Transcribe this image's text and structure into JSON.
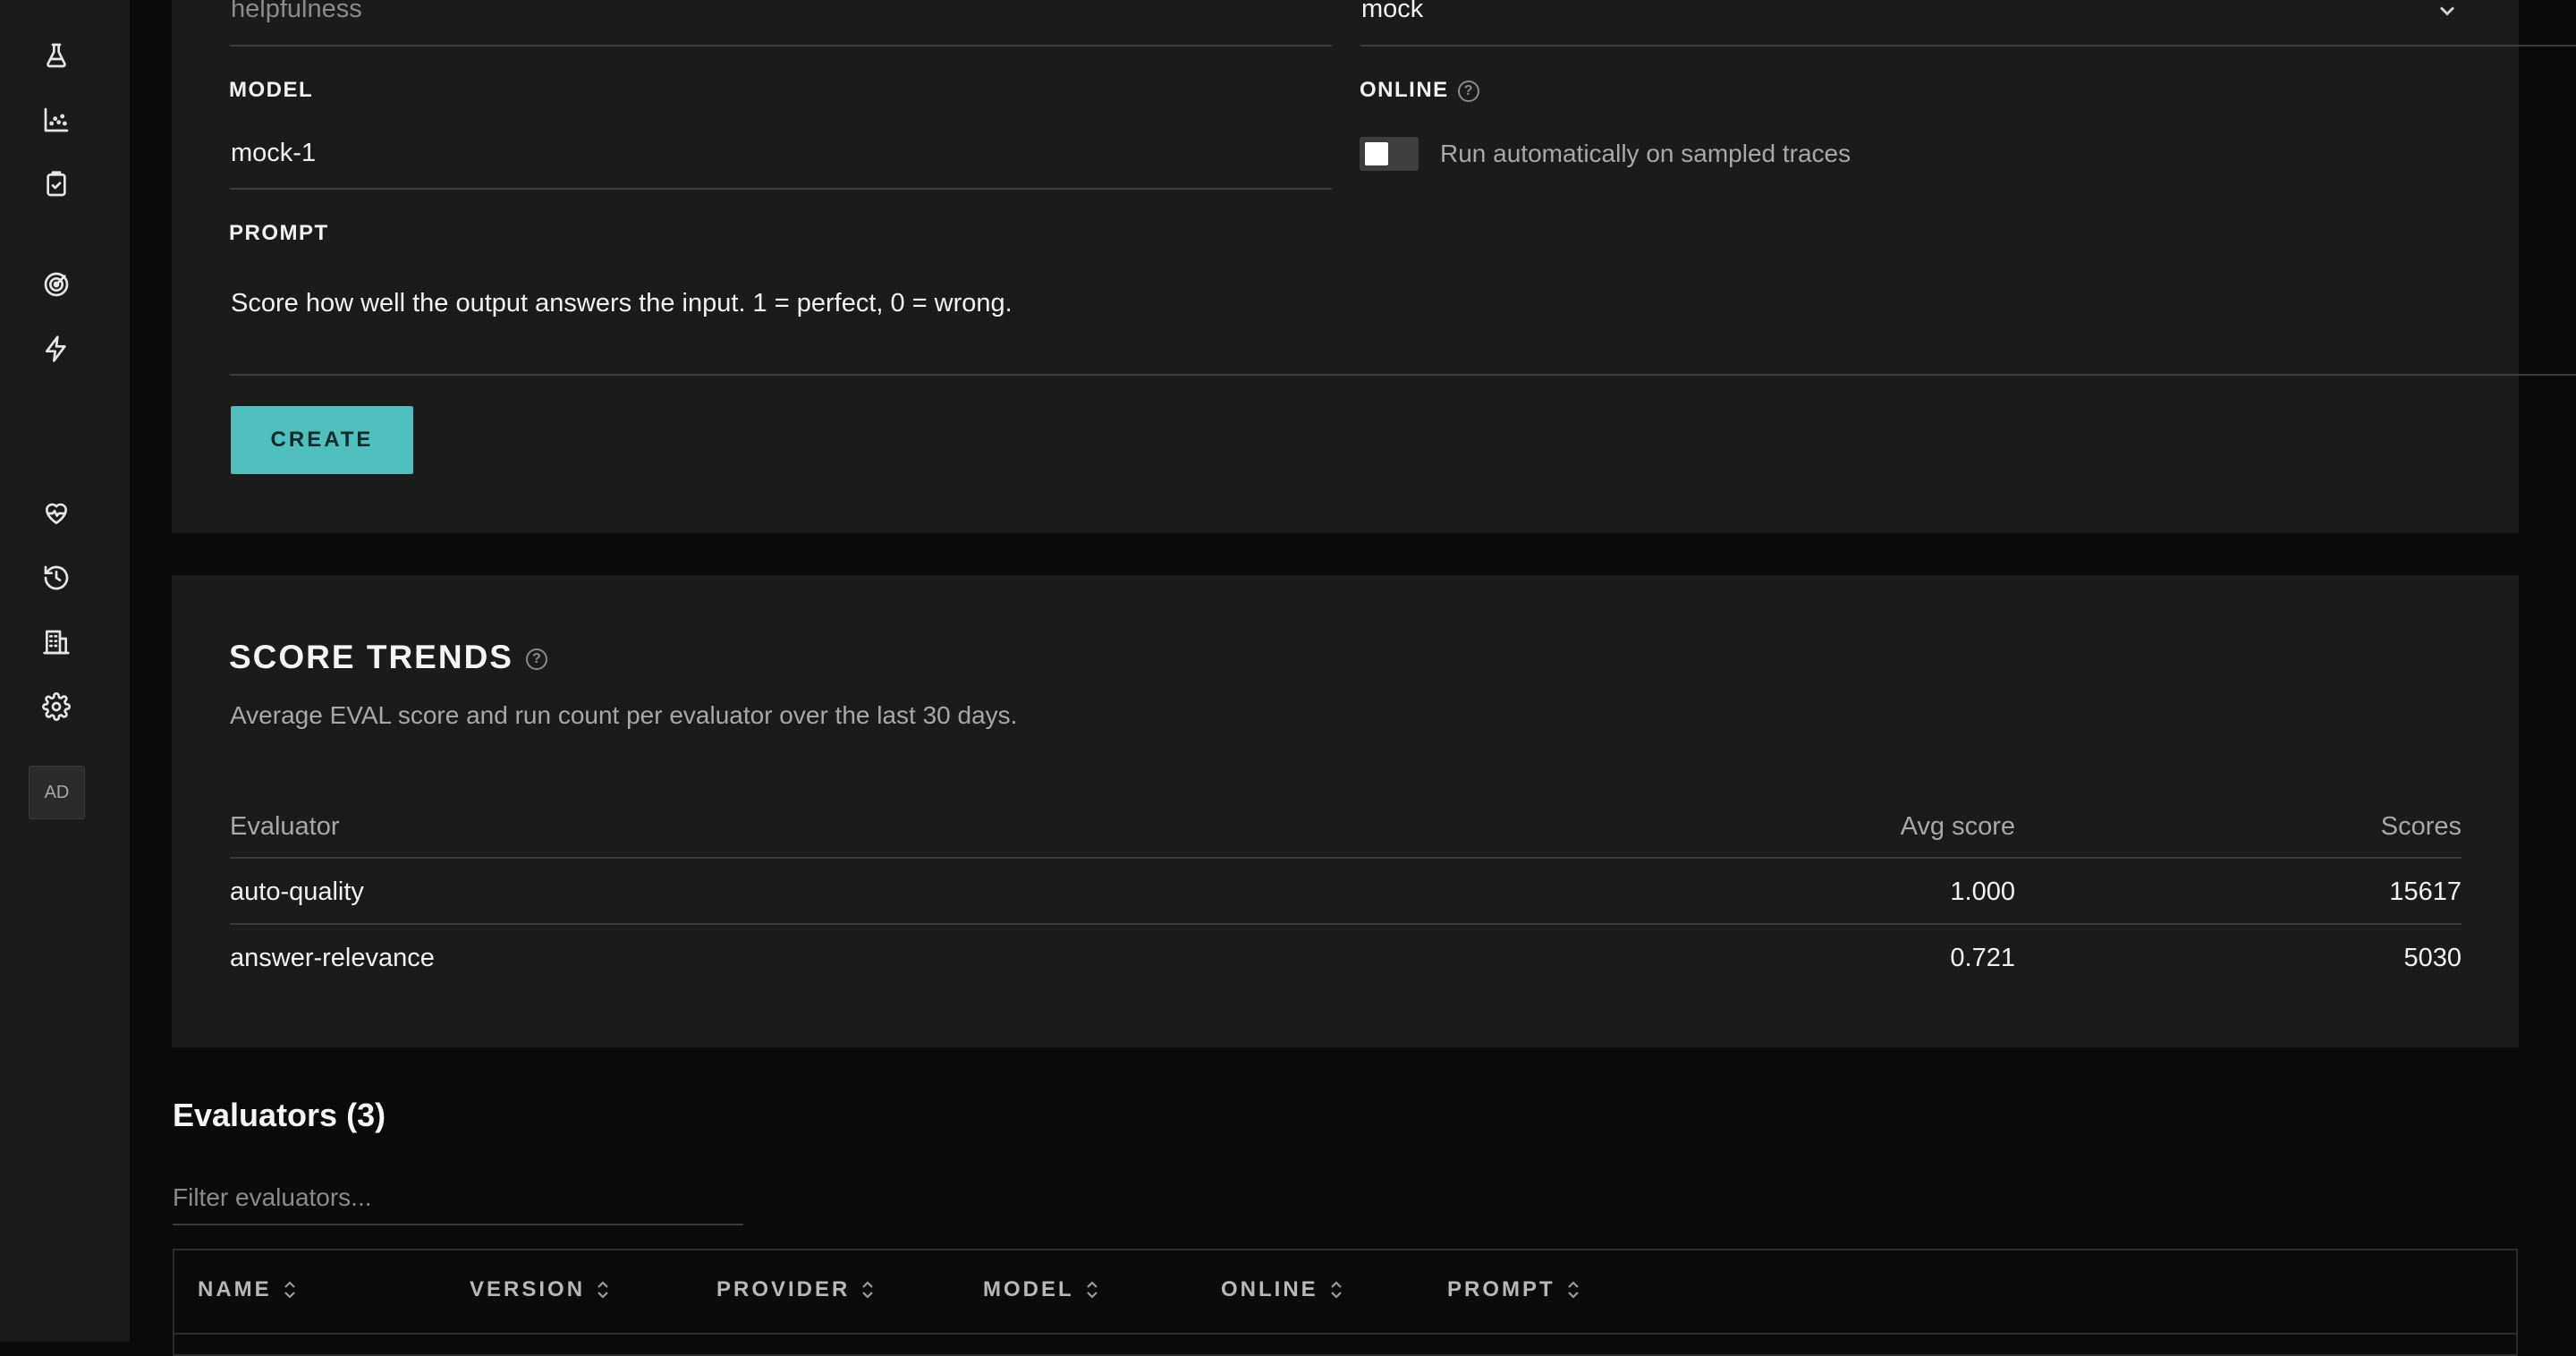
{
  "sidebar": {
    "icons": [
      "flask-icon",
      "scatter-chart-icon",
      "clipboard-check-icon",
      "target-icon",
      "lightning-icon",
      "heart-pulse-icon",
      "history-icon",
      "building-icon",
      "gear-icon"
    ],
    "avatar": "AD"
  },
  "form": {
    "name_value": "helpfulness",
    "provider_value": "mock",
    "model_label": "MODEL",
    "model_value": "mock-1",
    "online_label": "ONLINE",
    "online_enabled": false,
    "online_toggle_text": "Run automatically on sampled traces",
    "prompt_label": "PROMPT",
    "prompt_value": "Score how well the output answers the input. 1 = perfect, 0 = wrong.",
    "create_button": "CREATE"
  },
  "score_trends": {
    "title": "SCORE TRENDS",
    "subtitle": "Average EVAL score and run count per evaluator over the last 30 days.",
    "columns": [
      "Evaluator",
      "Avg score",
      "Scores"
    ],
    "rows": [
      {
        "evaluator": "auto-quality",
        "avg": "1.000",
        "scores": "15617"
      },
      {
        "evaluator": "answer-relevance",
        "avg": "0.721",
        "scores": "5030"
      }
    ]
  },
  "evaluators": {
    "title": "Evaluators (3)",
    "filter_placeholder": "Filter evaluators...",
    "columns": [
      "NAME",
      "VERSION",
      "PROVIDER",
      "MODEL",
      "ONLINE",
      "PROMPT"
    ]
  },
  "colors": {
    "accent": "#4fc0bd",
    "panel": "#1b1b1b",
    "background": "#0b0b0b"
  }
}
